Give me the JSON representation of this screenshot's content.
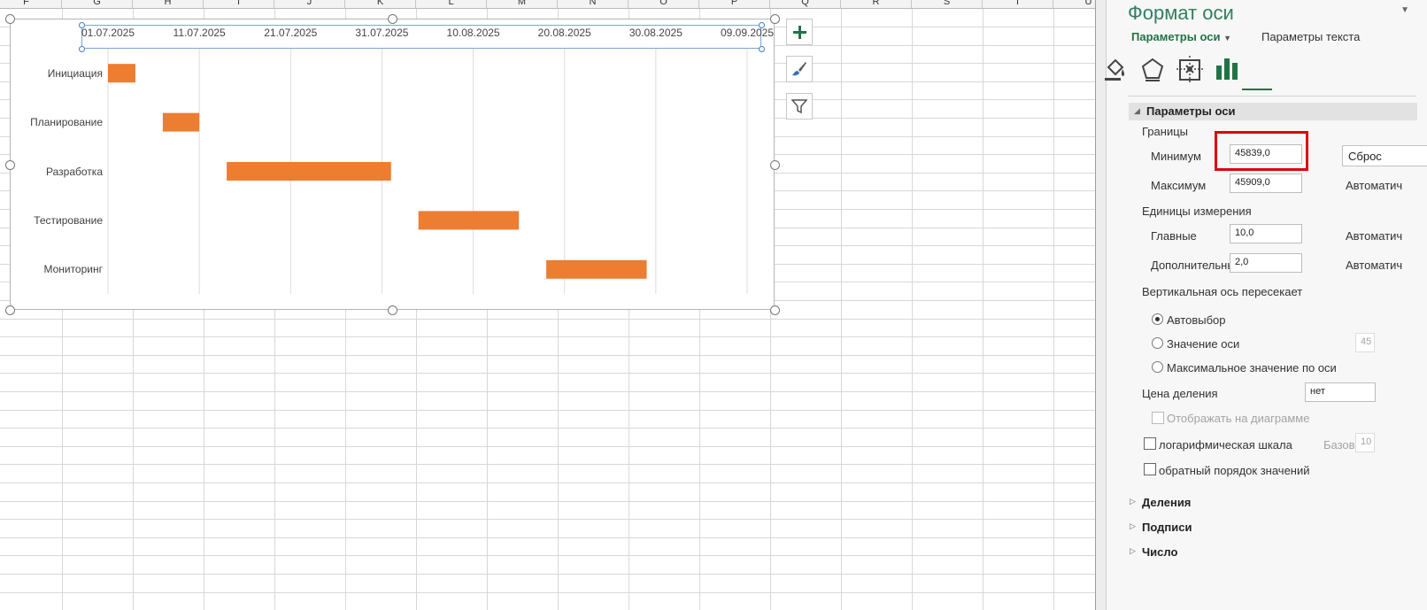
{
  "sheet": {
    "columns": [
      "F",
      "G",
      "H",
      "I",
      "J",
      "K",
      "L",
      "M",
      "N",
      "O",
      "P",
      "Q",
      "R",
      "S",
      "T",
      "U"
    ]
  },
  "chart": {
    "ticks": [
      "01.07.2025",
      "11.07.2025",
      "21.07.2025",
      "31.07.2025",
      "10.08.2025",
      "20.08.2025",
      "30.08.2025",
      "09.09.2025"
    ],
    "categories": [
      "Инициация",
      "Планирование",
      "Разработка",
      "Тестирование",
      "Мониторинг"
    ],
    "buttons": {
      "add": "add-element-icon",
      "styles": "brush-icon",
      "filters": "filter-icon"
    }
  },
  "chart_data": {
    "type": "bar",
    "orientation": "horizontal",
    "stacked": true,
    "x_axis": {
      "min": 45839,
      "max": 45909,
      "major_unit": 10,
      "minor_unit": 2,
      "format": "dd.mm.yyyy",
      "position": "top"
    },
    "categories": [
      "Инициация",
      "Планирование",
      "Разработка",
      "Тестирование",
      "Мониторинг"
    ],
    "series": [
      {
        "role": "start-offset",
        "hidden": true,
        "values": [
          0,
          6,
          13,
          34,
          48
        ]
      },
      {
        "color": "#ed7d31",
        "values": [
          3,
          4,
          18,
          11,
          11
        ]
      }
    ],
    "grid": true
  },
  "pane": {
    "title": "Формат оси",
    "close_icon": "dropdown-icon",
    "tab_axis": "Параметры оси",
    "tab_text": "Параметры текста",
    "section_axis": "Параметры оси",
    "bounds_label": "Границы",
    "min_label": "Минимум",
    "min_value": "45839,0",
    "min_button": "Сброс",
    "max_label": "Максимум",
    "max_value": "45909,0",
    "max_button": "Автоматич",
    "units_label": "Единицы измерения",
    "major_label": "Главные",
    "major_value": "10,0",
    "major_button": "Автоматич",
    "minor_label": "Дополнительные",
    "minor_value": "2,0",
    "minor_button": "Автоматич",
    "cross_label": "Вертикальная ось пересекает",
    "radio_auto": "Автовыбор",
    "radio_value": "Значение оси",
    "radio_value_input": "45",
    "radio_max": "Максимальное значение по оси",
    "display_units_label": "Цена деления",
    "display_units_value": "нет",
    "show_on_chart": "Отображать на диаграмме",
    "log_scale": "логарифмическая шкала",
    "log_base_label": "Базовая",
    "log_base_value": "10",
    "reverse_order": "обратный порядок значений",
    "section_ticks": "Деления",
    "section_labels": "Подписи",
    "section_number": "Число"
  }
}
